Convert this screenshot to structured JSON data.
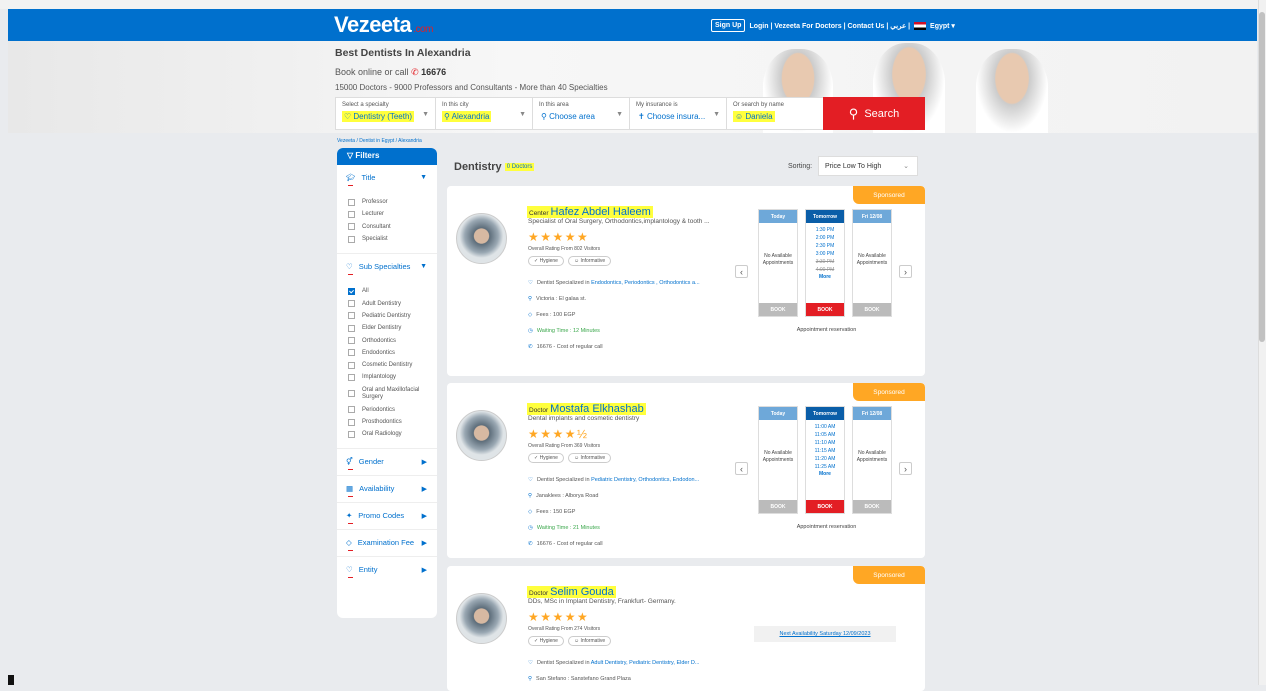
{
  "nav": {
    "logo": "Vezeeta",
    "logo_tail": ".com",
    "signup": "Sign Up",
    "links": "Login | Vezeeta For Doctors | Contact Us | عربي |",
    "country": "Egypt ▾"
  },
  "hero": {
    "title": "Best Dentists In Alexandria",
    "call_prefix": "Book online or call",
    "call_number": "16676",
    "subtitle": "15000 Doctors - 9000 Professors and Consultants - More than 40 Specialties"
  },
  "search": {
    "specialty_label": "Select a specialty",
    "specialty_value": "Dentistry (Teeth)",
    "city_label": "In this city",
    "city_value": "Alexandria",
    "area_label": "In this area",
    "area_value": "Choose area",
    "insurance_label": "My insurance is",
    "insurance_value": "Choose insura...",
    "name_label": "Or search by name",
    "name_value": "Daniela",
    "button": "Search"
  },
  "breadcrumb": "Vezeeta / Dentist in Egypt / Alexandria",
  "filters": {
    "header": "Filters",
    "title": {
      "label": "Title",
      "options": [
        "Professor",
        "Lecturer",
        "Consultant",
        "Specialist"
      ]
    },
    "sub": {
      "label": "Sub Specialties",
      "options": [
        "All",
        "Adult Dentistry",
        "Pediatric Dentistry",
        "Elder Dentistry",
        "Orthodontics",
        "Endodontics",
        "Cosmetic Dentistry",
        "Implantology",
        "Oral and Maxillofacial Surgery",
        "Periodontics",
        "Prosthodontics",
        "Oral Radiology"
      ]
    },
    "gender": "Gender",
    "availability": "Availability",
    "promo": "Promo Codes",
    "fee": "Examination Fee",
    "entity": "Entity"
  },
  "results": {
    "heading": "Dentistry",
    "count": "0 Doctors",
    "sort_label": "Sorting:",
    "sort_value": "Price Low To High"
  },
  "common": {
    "sponsored": "Sponsored",
    "hygiene": "Hygiene",
    "informative": "Informative",
    "today": "Today",
    "tomorrow": "Tomorrow",
    "fri": "Fri 12/08",
    "no_avail": "No Available Appointments",
    "book": "BOOK",
    "more": "More",
    "appt": "Appointment reservation",
    "call_info": "16676 - Cost of regular call"
  },
  "doctors": [
    {
      "prefix": "Center",
      "name": "Hafez Abdel Haleem",
      "specialty": "Specialist of Oral Surgery, Orthodontics,implantology & tooth ...",
      "rating_stars": "★★★★★",
      "rating_text": "Overall Rating From 802 Visitors",
      "dentist_text": "Dentist Specialized in",
      "dentist_links": "Endodontics, Periodontics , Orthodontics a...",
      "location": "Victoria : El galaa st.",
      "fees": "Fees : 100 EGP",
      "waiting": "Waiting Time : 12 Minutes",
      "slots": [
        "1:30 PM",
        "2:00 PM",
        "2:30 PM",
        "3:00 PM",
        "3:30 PM",
        "4:00 PM"
      ]
    },
    {
      "prefix": "Doctor",
      "name": "Mostafa Elkhashab",
      "specialty": "Dental implants and cosmetic dentistry",
      "rating_stars": "★★★★½",
      "rating_text": "Overall Rating From 369 Visitors",
      "dentist_text": "Dentist Specialized in",
      "dentist_links": "Pediatric Dentistry, Orthodontics, Endodon...",
      "location": "Janaklees : Alborya Road",
      "fees": "Fees : 150 EGP",
      "waiting": "Waiting Time : 21 Minutes",
      "slots": [
        "11:00 AM",
        "11:05 AM",
        "11:10 AM",
        "11:15 AM",
        "11:20 AM",
        "11:25 AM"
      ]
    },
    {
      "prefix": "Doctor",
      "name": "Selim Gouda",
      "specialty": "DDs, MSc in Implant Dentistry, Frankfurt- Germany.",
      "rating_stars": "★★★★★",
      "rating_text": "Overall Rating From 274 Visitors",
      "dentist_text": "Dentist Specialized in",
      "dentist_links": "Adult Dentistry, Pediatric Dentistry, Elder D...",
      "location": "San Stefano : Sanstefano Grand Plaza",
      "next_avail": "Next Availability Saturday 12/09/2023"
    }
  ]
}
